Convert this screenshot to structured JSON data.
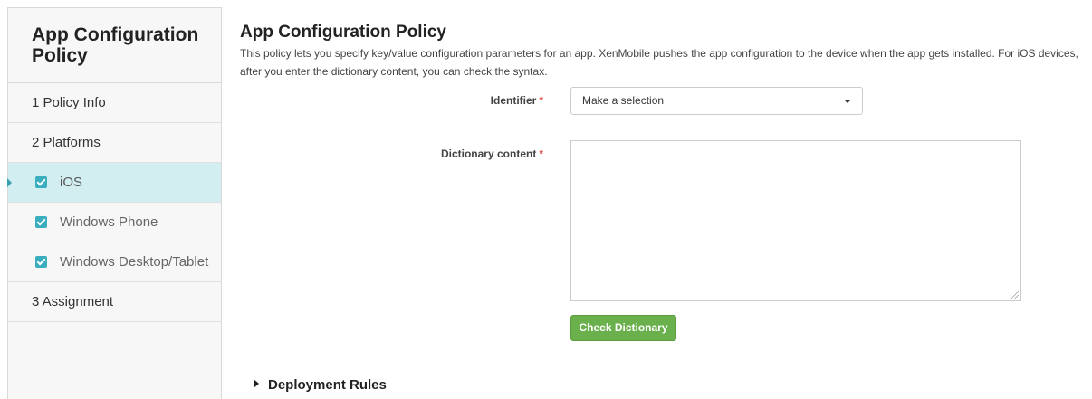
{
  "sidebar": {
    "title": "App Configuration Policy",
    "items": [
      {
        "label": "1  Policy Info"
      },
      {
        "label": "2  Platforms"
      },
      {
        "label": "iOS"
      },
      {
        "label": "Windows Phone"
      },
      {
        "label": "Windows Desktop/Tablet"
      },
      {
        "label": "3  Assignment"
      }
    ]
  },
  "main": {
    "title": "App Configuration Policy",
    "description": "This policy lets you specify key/value configuration parameters for an app. XenMobile pushes the app configuration to the device when the app gets installed. For iOS devices, after you enter the dictionary content, you can check the syntax.",
    "identifier_label": "Identifier",
    "identifier_value": "Make a selection",
    "dictionary_label": "Dictionary content",
    "required_mark": "*",
    "check_button": "Check Dictionary",
    "deployment_rules": "Deployment Rules"
  },
  "colors": {
    "accent_teal": "#3aaebf",
    "active_row": "#d3eef0",
    "button_green": "#6ab04c",
    "required": "#d9534f"
  }
}
